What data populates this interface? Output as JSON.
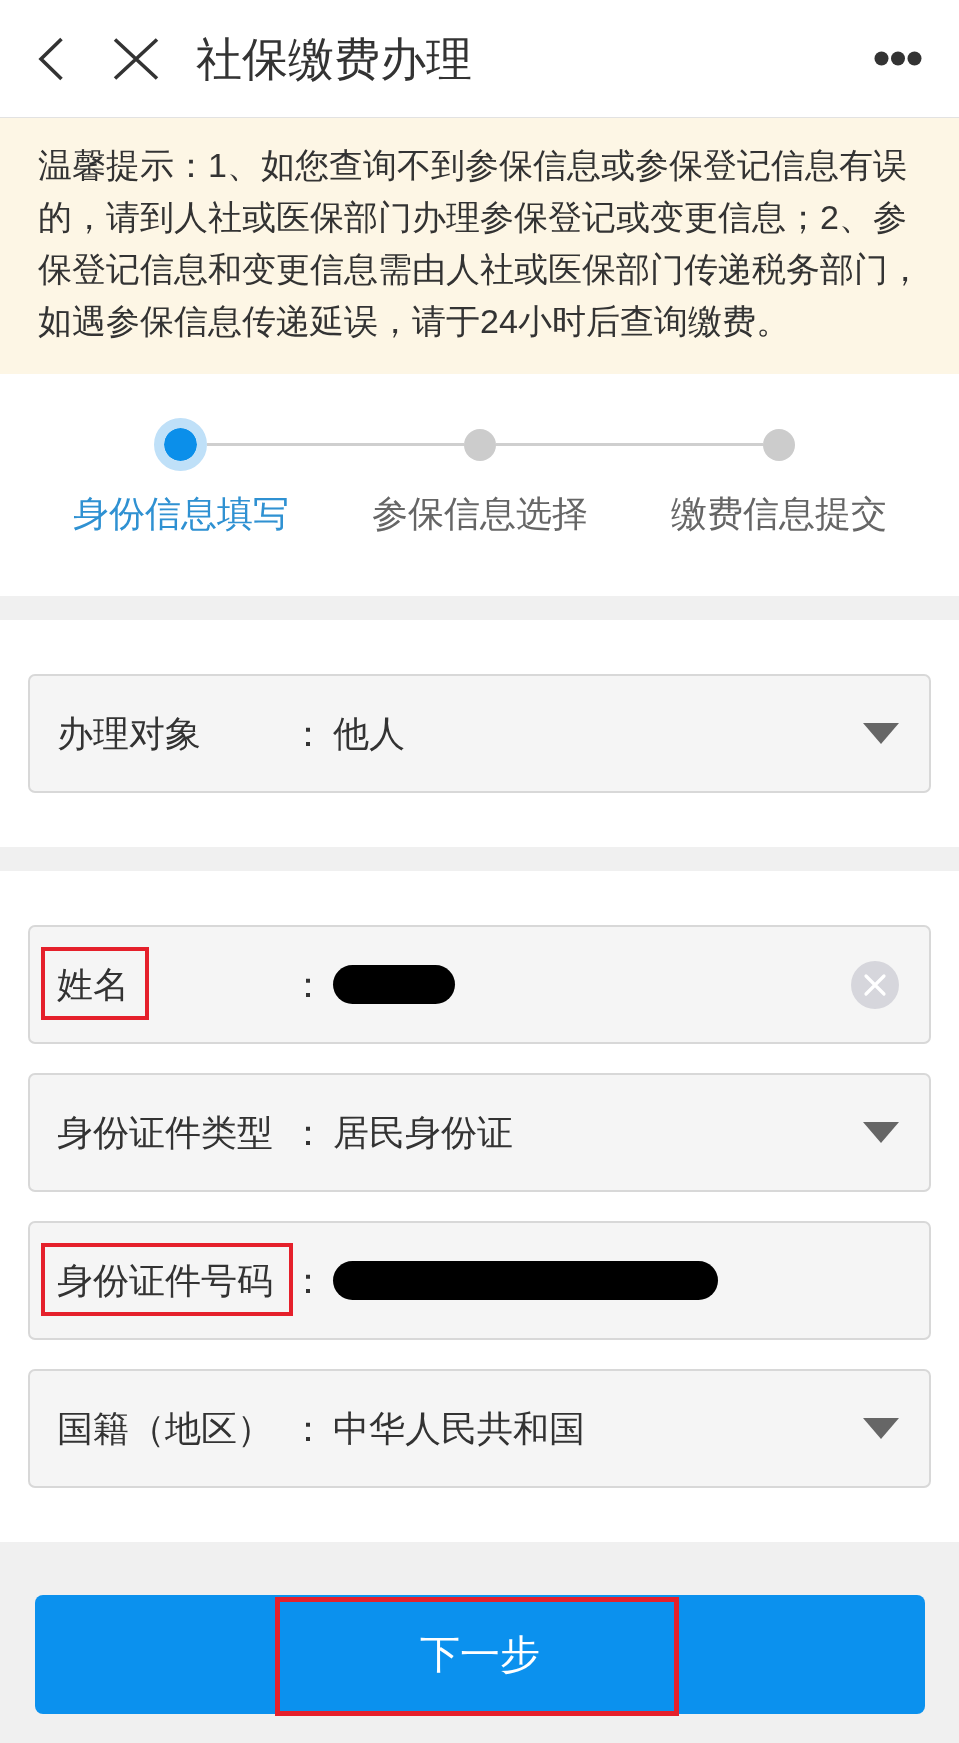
{
  "header": {
    "title": "社保缴费办理"
  },
  "notice": {
    "text": "温馨提示：1、如您查询不到参保信息或参保登记信息有误的，请到人社或医保部门办理参保登记或变更信息；2、参保登记信息和变更信息需由人社或医保部门传递税务部门，如遇参保信息传递延误，请于24小时后查询缴费。"
  },
  "steps": [
    {
      "label": "身份信息填写",
      "selected": true
    },
    {
      "label": "参保信息选择",
      "selected": false
    },
    {
      "label": "缴费信息提交",
      "selected": false
    }
  ],
  "sections": [
    {
      "fields": [
        {
          "kind": "dropdown",
          "label": "办理对象",
          "colon": "：",
          "value": "他人",
          "redacted": false,
          "highlighted": false
        }
      ]
    },
    {
      "fields": [
        {
          "kind": "clearable",
          "label": "姓名",
          "colon": "：",
          "redacted": true,
          "highlighted": true
        },
        {
          "kind": "dropdown",
          "label": "身份证件类型",
          "colon": "：",
          "value": "居民身份证",
          "redacted": false,
          "highlighted": false
        },
        {
          "kind": "input",
          "label": "身份证件号码",
          "colon": "：",
          "redacted": true,
          "highlighted": true
        },
        {
          "kind": "dropdown",
          "label": "国籍（地区）",
          "colon": "：",
          "value": "中华人民共和国",
          "redacted": false,
          "highlighted": false
        }
      ]
    }
  ],
  "next_button": {
    "label": "下一步",
    "highlighted": true
  }
}
